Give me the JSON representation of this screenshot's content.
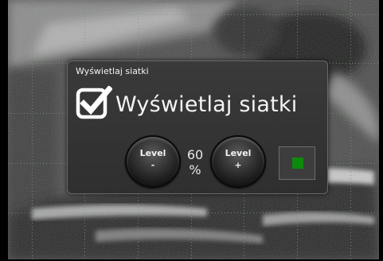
{
  "dialog": {
    "title": "Wyświetlaj siatki",
    "checkbox_label": "Wyświetlaj siatki",
    "checkbox_checked": true
  },
  "level": {
    "minus_label": "Level",
    "minus_sign": "-",
    "plus_label": "Level",
    "plus_sign": "+",
    "value": "60",
    "unit": "%"
  },
  "indicator": {
    "color": "#0d8a0d"
  },
  "colors": {
    "panel_bg": "#333333",
    "grid_line": "#6f9a6f",
    "indicator_on": "#0d8a0d"
  }
}
